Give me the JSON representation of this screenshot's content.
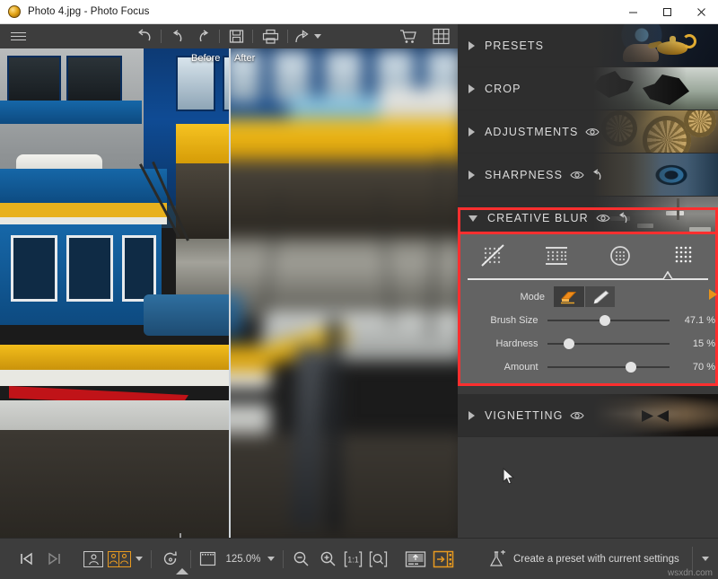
{
  "window": {
    "title": "Photo 4.jpg - Photo Focus",
    "app_icon": "photo-focus-orb-icon",
    "controls": {
      "minimize": "minimize-icon",
      "maximize": "maximize-icon",
      "close": "close-icon"
    }
  },
  "top_toolbar": {
    "items": [
      {
        "name": "menu-button",
        "icon": "hamburger-icon",
        "label": "Menu"
      },
      {
        "name": "revert-button",
        "icon": "revert-arrow-icon",
        "label": "Revert"
      },
      {
        "name": "undo-button",
        "icon": "undo-arrow-icon",
        "label": "Undo"
      },
      {
        "name": "redo-button",
        "icon": "redo-arrow-icon",
        "label": "Redo"
      },
      {
        "name": "save-button",
        "icon": "floppy-disk-icon",
        "label": "Save"
      },
      {
        "name": "print-button",
        "icon": "printer-icon",
        "label": "Print"
      },
      {
        "name": "share-button",
        "icon": "share-arrow-icon",
        "label": "Share"
      },
      {
        "name": "cart-button",
        "icon": "shopping-cart-icon",
        "label": "Store"
      },
      {
        "name": "grid-button",
        "icon": "grid-icon",
        "label": "Grid"
      }
    ]
  },
  "preview": {
    "before_label": "Before",
    "after_label": "After",
    "subject": "blue and yellow fishing boats in harbour"
  },
  "bottom_toolbar": {
    "prev_label": "Previous image",
    "next_label": "Next image",
    "single_view_label": "Single view",
    "split_view_label": "Split view",
    "rotate_label": "Rotate",
    "crop_box_label": "Selection",
    "zoom_value": "125.0%",
    "zoom_out_label": "Zoom out",
    "zoom_in_label": "Zoom in",
    "actual_size_label": "1:1",
    "fit_label": "Fit to window",
    "compare_label": "Compare",
    "panel_toggle_label": "Toggle panel"
  },
  "panel": {
    "sections": [
      {
        "title": "PRESETS",
        "expanded": false,
        "has_eye": false,
        "has_reset": false
      },
      {
        "title": "CROP",
        "expanded": false,
        "has_eye": false,
        "has_reset": false
      },
      {
        "title": "ADJUSTMENTS",
        "expanded": false,
        "has_eye": true,
        "has_reset": false
      },
      {
        "title": "SHARPNESS",
        "expanded": false,
        "has_eye": true,
        "has_reset": true
      },
      {
        "title": "CREATIVE BLUR",
        "expanded": true,
        "has_eye": true,
        "has_reset": true
      },
      {
        "title": "VIGNETTING",
        "expanded": false,
        "has_eye": true,
        "has_reset": false
      }
    ],
    "creative_blur": {
      "blur_types": [
        {
          "name": "no-blur",
          "label": "No blur",
          "selected": false
        },
        {
          "name": "linear-blur",
          "label": "Linear blur",
          "selected": false
        },
        {
          "name": "radial-blur",
          "label": "Radial blur",
          "selected": false
        },
        {
          "name": "full-blur",
          "label": "Full blur",
          "selected": true
        }
      ],
      "mode": {
        "label": "Mode",
        "options": [
          {
            "name": "eraser-tool",
            "label": "Eraser",
            "selected": true
          },
          {
            "name": "brush-tool",
            "label": "Brush",
            "selected": false
          }
        ]
      },
      "sliders": [
        {
          "label": "Brush Size",
          "value": "47.1 %",
          "percent": 47.1
        },
        {
          "label": "Hardness",
          "value": "15 %",
          "percent": 15
        },
        {
          "label": "Amount",
          "value": "70 %",
          "percent": 70
        }
      ]
    }
  },
  "preset_bar": {
    "label": "Create a preset with current settings",
    "icon": "flask-plus-icon",
    "dropdown": "chevron-down-icon"
  },
  "watermark": "wsxdn.com",
  "colors": {
    "accent_orange": "#e89a20",
    "highlight_red": "#ff2f2f",
    "panel_bg": "#3a3a3a",
    "toolbar_bg": "#3d3d3d",
    "blur_body_bg": "#636363"
  }
}
